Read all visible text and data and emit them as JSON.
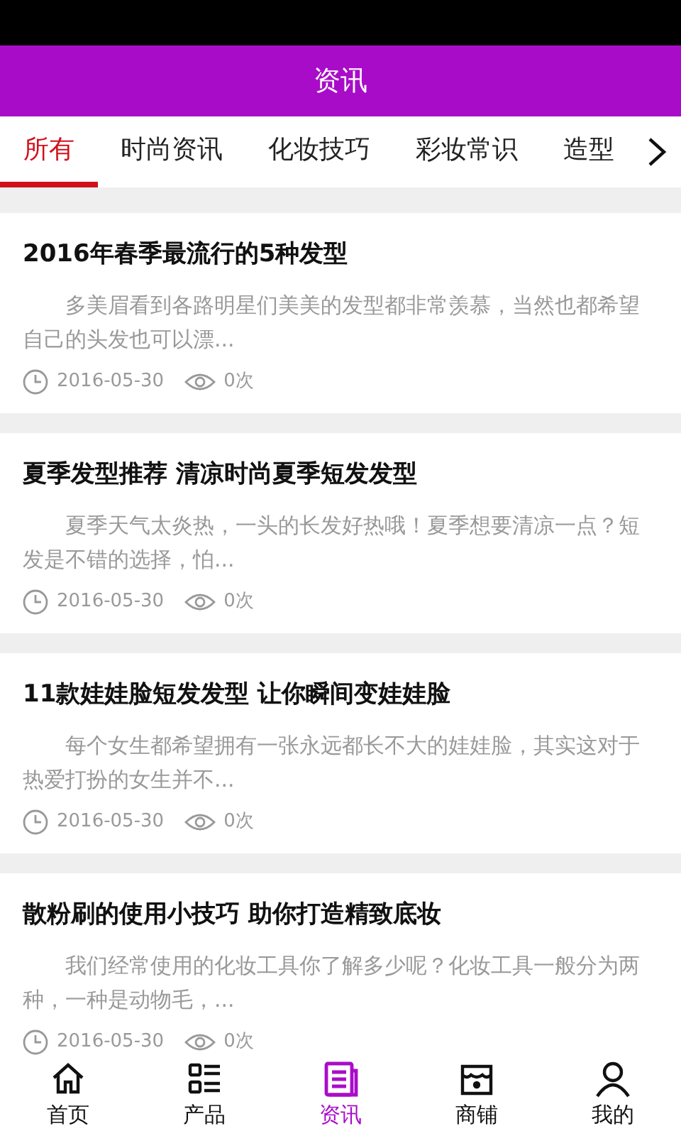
{
  "header": {
    "title": "资讯"
  },
  "tabs": [
    {
      "label": "所有",
      "selected": true
    },
    {
      "label": "时尚资讯",
      "selected": false
    },
    {
      "label": "化妆技巧",
      "selected": false
    },
    {
      "label": "彩妆常识",
      "selected": false
    },
    {
      "label": "造型",
      "selected": false
    }
  ],
  "articles": [
    {
      "title": "2016年春季最流行的5种发型",
      "summary": "多美眉看到各路明星们美美的发型都非常羡慕，当然也都希望自己的头发也可以漂...",
      "date": "2016-05-30",
      "views": "0次"
    },
    {
      "title": "夏季发型推荐 清凉时尚夏季短发发型",
      "summary": "夏季天气太炎热，一头的长发好热哦！夏季想要清凉一点？短发是不错的选择，怕...",
      "date": "2016-05-30",
      "views": "0次"
    },
    {
      "title": "11款娃娃脸短发发型 让你瞬间变娃娃脸",
      "summary": "每个女生都希望拥有一张永远都长不大的娃娃脸，其实这对于热爱打扮的女生并不...",
      "date": "2016-05-30",
      "views": "0次"
    },
    {
      "title": "散粉刷的使用小技巧 助你打造精致底妆",
      "summary": "我们经常使用的化妆工具你了解多少呢？化妆工具一般分为两种，一种是动物毛，...",
      "date": "2016-05-30",
      "views": "0次"
    }
  ],
  "bottom_nav": [
    {
      "kind": "home",
      "label": "首页",
      "selected": false
    },
    {
      "kind": "list",
      "label": "产品",
      "selected": false
    },
    {
      "kind": "news",
      "label": "资讯",
      "selected": true
    },
    {
      "kind": "shop",
      "label": "商铺",
      "selected": false
    },
    {
      "kind": "user",
      "label": "我的",
      "selected": false
    }
  ]
}
